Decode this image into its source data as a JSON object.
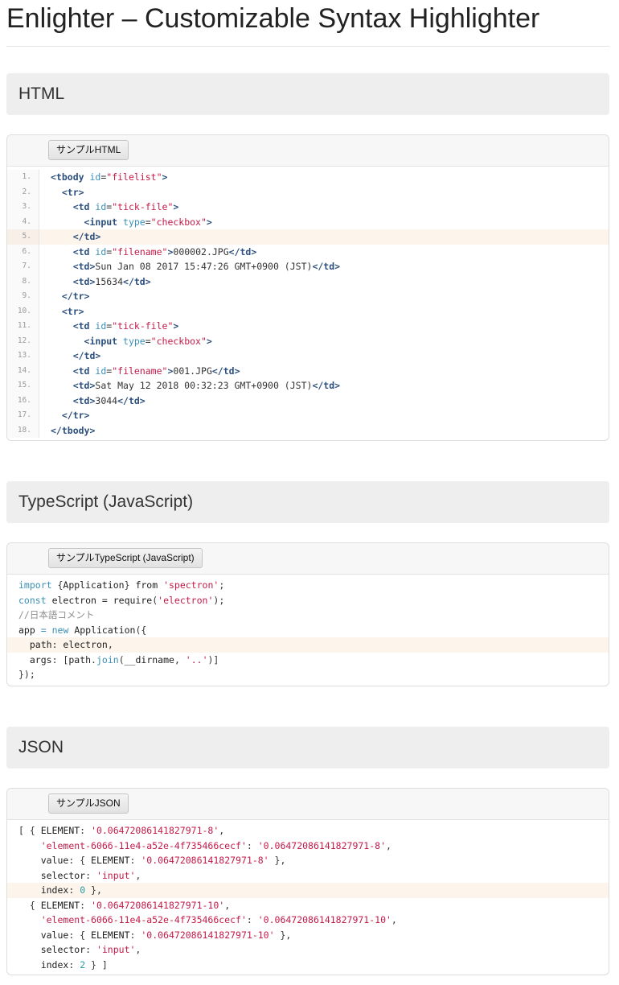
{
  "page": {
    "title": "Enlighter – Customizable Syntax Highlighter"
  },
  "sections": [
    {
      "heading": "HTML",
      "button": "サンプルHTML",
      "numbered": true,
      "highlight_line": 5,
      "lines": [
        [
          [
            "tag",
            "<tbody"
          ],
          [
            "p",
            " "
          ],
          [
            "attr",
            "id"
          ],
          [
            "p",
            "="
          ],
          [
            "str",
            "\"filelist\""
          ],
          [
            "tag",
            ">"
          ]
        ],
        [
          [
            "p",
            "  "
          ],
          [
            "tag",
            "<tr>"
          ]
        ],
        [
          [
            "p",
            "    "
          ],
          [
            "tag",
            "<td"
          ],
          [
            "p",
            " "
          ],
          [
            "attr",
            "id"
          ],
          [
            "p",
            "="
          ],
          [
            "str",
            "\"tick-file\""
          ],
          [
            "tag",
            ">"
          ]
        ],
        [
          [
            "p",
            "      "
          ],
          [
            "tag",
            "<input"
          ],
          [
            "p",
            " "
          ],
          [
            "attr",
            "type"
          ],
          [
            "p",
            "="
          ],
          [
            "str",
            "\"checkbox\""
          ],
          [
            "tag",
            ">"
          ]
        ],
        [
          [
            "p",
            "    "
          ],
          [
            "tag",
            "</td>"
          ]
        ],
        [
          [
            "p",
            "    "
          ],
          [
            "tag",
            "<td"
          ],
          [
            "p",
            " "
          ],
          [
            "attr",
            "id"
          ],
          [
            "p",
            "="
          ],
          [
            "str",
            "\"filename\""
          ],
          [
            "tag",
            ">"
          ],
          [
            "p",
            "000002.JPG"
          ],
          [
            "tag",
            "</td>"
          ]
        ],
        [
          [
            "p",
            "    "
          ],
          [
            "tag",
            "<td>"
          ],
          [
            "p",
            "Sun Jan 08 2017 15:47:26 GMT+0900 (JST)"
          ],
          [
            "tag",
            "</td>"
          ]
        ],
        [
          [
            "p",
            "    "
          ],
          [
            "tag",
            "<td>"
          ],
          [
            "p",
            "15634"
          ],
          [
            "tag",
            "</td>"
          ]
        ],
        [
          [
            "p",
            "  "
          ],
          [
            "tag",
            "</tr>"
          ]
        ],
        [
          [
            "p",
            "  "
          ],
          [
            "tag",
            "<tr>"
          ]
        ],
        [
          [
            "p",
            "    "
          ],
          [
            "tag",
            "<td"
          ],
          [
            "p",
            " "
          ],
          [
            "attr",
            "id"
          ],
          [
            "p",
            "="
          ],
          [
            "str",
            "\"tick-file\""
          ],
          [
            "tag",
            ">"
          ]
        ],
        [
          [
            "p",
            "      "
          ],
          [
            "tag",
            "<input"
          ],
          [
            "p",
            " "
          ],
          [
            "attr",
            "type"
          ],
          [
            "p",
            "="
          ],
          [
            "str",
            "\"checkbox\""
          ],
          [
            "tag",
            ">"
          ]
        ],
        [
          [
            "p",
            "    "
          ],
          [
            "tag",
            "</td>"
          ]
        ],
        [
          [
            "p",
            "    "
          ],
          [
            "tag",
            "<td"
          ],
          [
            "p",
            " "
          ],
          [
            "attr",
            "id"
          ],
          [
            "p",
            "="
          ],
          [
            "str",
            "\"filename\""
          ],
          [
            "tag",
            ">"
          ],
          [
            "p",
            "001.JPG"
          ],
          [
            "tag",
            "</td>"
          ]
        ],
        [
          [
            "p",
            "    "
          ],
          [
            "tag",
            "<td>"
          ],
          [
            "p",
            "Sat May 12 2018 00:32:23 GMT+0900 (JST)"
          ],
          [
            "tag",
            "</td>"
          ]
        ],
        [
          [
            "p",
            "    "
          ],
          [
            "tag",
            "<td>"
          ],
          [
            "p",
            "3044"
          ],
          [
            "tag",
            "</td>"
          ]
        ],
        [
          [
            "p",
            "  "
          ],
          [
            "tag",
            "</tr>"
          ]
        ],
        [
          [
            "tag",
            "</tbody>"
          ]
        ]
      ]
    },
    {
      "heading": "TypeScript (JavaScript)",
      "button": "サンプルTypeScript (JavaScript)",
      "numbered": false,
      "highlight_line": 5,
      "lines": [
        [
          [
            "kw",
            "import"
          ],
          [
            "p",
            " {"
          ],
          [
            "id",
            "Application"
          ],
          [
            "p",
            "} "
          ],
          [
            "id",
            "from"
          ],
          [
            "p",
            " "
          ],
          [
            "str",
            "'spectron'"
          ],
          [
            "p",
            ";"
          ]
        ],
        [
          [
            "kw",
            "const"
          ],
          [
            "p",
            " "
          ],
          [
            "id",
            "electron"
          ],
          [
            "p",
            " = "
          ],
          [
            "id",
            "require"
          ],
          [
            "p",
            "("
          ],
          [
            "str",
            "'electron'"
          ],
          [
            "p",
            ");"
          ]
        ],
        [
          [
            "cm",
            "//日本語コメント"
          ]
        ],
        [
          [
            "id",
            "app"
          ],
          [
            "p",
            " "
          ],
          [
            "kw",
            "="
          ],
          [
            "p",
            " "
          ],
          [
            "kw",
            "new"
          ],
          [
            "p",
            " "
          ],
          [
            "id",
            "Application"
          ],
          [
            "p",
            "({"
          ]
        ],
        [
          [
            "p",
            "  "
          ],
          [
            "id",
            "path"
          ],
          [
            "p",
            ": "
          ],
          [
            "id",
            "electron"
          ],
          [
            "p",
            ","
          ]
        ],
        [
          [
            "p",
            "  "
          ],
          [
            "id",
            "args"
          ],
          [
            "p",
            ": ["
          ],
          [
            "id",
            "path"
          ],
          [
            "p",
            "."
          ],
          [
            "kw",
            "join"
          ],
          [
            "p",
            "("
          ],
          [
            "id",
            "__dirname"
          ],
          [
            "p",
            ", "
          ],
          [
            "str",
            "'..'"
          ],
          [
            "p",
            ")]"
          ]
        ],
        [
          [
            "p",
            "});"
          ]
        ]
      ]
    },
    {
      "heading": "JSON",
      "button": "サンプルJSON",
      "numbered": false,
      "highlight_line": 5,
      "lines": [
        [
          [
            "p",
            "[ { "
          ],
          [
            "id",
            "ELEMENT"
          ],
          [
            "p",
            ": "
          ],
          [
            "str",
            "'0.06472086141827971-8'"
          ],
          [
            "p",
            ","
          ]
        ],
        [
          [
            "p",
            "    "
          ],
          [
            "str",
            "'element-6066-11e4-a52e-4f735466cecf'"
          ],
          [
            "p",
            ": "
          ],
          [
            "str",
            "'0.06472086141827971-8'"
          ],
          [
            "p",
            ","
          ]
        ],
        [
          [
            "p",
            "    "
          ],
          [
            "id",
            "value"
          ],
          [
            "p",
            ": { "
          ],
          [
            "id",
            "ELEMENT"
          ],
          [
            "p",
            ": "
          ],
          [
            "str",
            "'0.06472086141827971-8'"
          ],
          [
            "p",
            " },"
          ]
        ],
        [
          [
            "p",
            "    "
          ],
          [
            "id",
            "selector"
          ],
          [
            "p",
            ": "
          ],
          [
            "str",
            "'input'"
          ],
          [
            "p",
            ","
          ]
        ],
        [
          [
            "p",
            "    "
          ],
          [
            "id",
            "index"
          ],
          [
            "p",
            ": "
          ],
          [
            "num",
            "0"
          ],
          [
            "p",
            " },"
          ]
        ],
        [
          [
            "p",
            "  { "
          ],
          [
            "id",
            "ELEMENT"
          ],
          [
            "p",
            ": "
          ],
          [
            "str",
            "'0.06472086141827971-10'"
          ],
          [
            "p",
            ","
          ]
        ],
        [
          [
            "p",
            "    "
          ],
          [
            "str",
            "'element-6066-11e4-a52e-4f735466cecf'"
          ],
          [
            "p",
            ": "
          ],
          [
            "str",
            "'0.06472086141827971-10'"
          ],
          [
            "p",
            ","
          ]
        ],
        [
          [
            "p",
            "    "
          ],
          [
            "id",
            "value"
          ],
          [
            "p",
            ": { "
          ],
          [
            "id",
            "ELEMENT"
          ],
          [
            "p",
            ": "
          ],
          [
            "str",
            "'0.06472086141827971-10'"
          ],
          [
            "p",
            " },"
          ]
        ],
        [
          [
            "p",
            "    "
          ],
          [
            "id",
            "selector"
          ],
          [
            "p",
            ": "
          ],
          [
            "str",
            "'input'"
          ],
          [
            "p",
            ","
          ]
        ],
        [
          [
            "p",
            "    "
          ],
          [
            "id",
            "index"
          ],
          [
            "p",
            ": "
          ],
          [
            "num",
            "2"
          ],
          [
            "p",
            " } ]"
          ]
        ]
      ]
    }
  ]
}
